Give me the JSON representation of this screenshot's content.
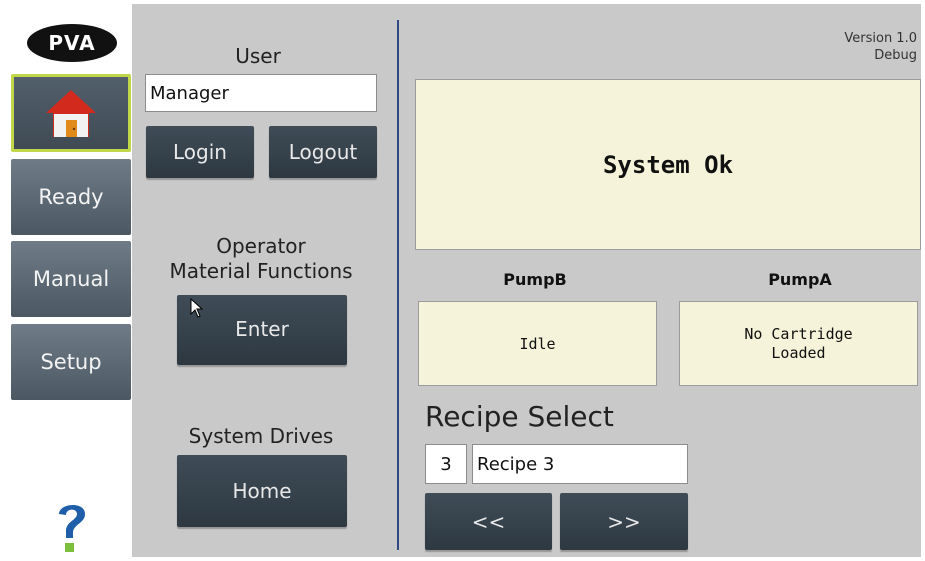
{
  "nav": {
    "logo_text": "PVA",
    "home_icon": "home-icon",
    "ready_label": "Ready",
    "manual_label": "Manual",
    "setup_label": "Setup",
    "help_icon": "help-icon"
  },
  "user": {
    "label": "User",
    "value": "Manager",
    "login_label": "Login",
    "logout_label": "Logout"
  },
  "operator": {
    "label_line1": "Operator",
    "label_line2": "Material Functions",
    "enter_label": "Enter"
  },
  "drives": {
    "label": "System Drives",
    "home_label": "Home"
  },
  "version": {
    "line1": "Version 1.0",
    "line2": "Debug"
  },
  "status": {
    "text": "System Ok"
  },
  "pumps": {
    "pumpB_label": "PumpB",
    "pumpB_status": "Idle",
    "pumpA_label": "PumpA",
    "pumpA_status_line1": "No Cartridge",
    "pumpA_status_line2": "Loaded"
  },
  "recipe": {
    "label": "Recipe Select",
    "number": "3",
    "name": "Recipe 3",
    "prev_label": "<<",
    "next_label": ">>"
  },
  "colors": {
    "background": "#c9c9c9",
    "button": "#2d3841",
    "nav_button": "#5a6772",
    "panel": "#f5f4da",
    "home_highlight": "#c2d64a",
    "divider": "#2f4a80"
  }
}
